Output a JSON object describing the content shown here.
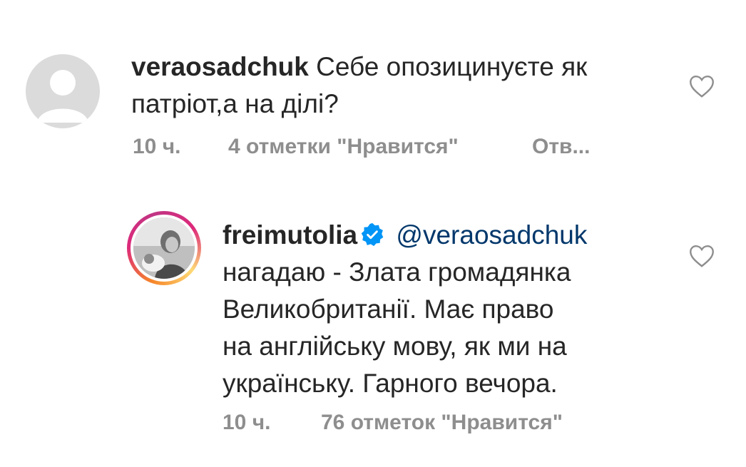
{
  "comments": [
    {
      "username": "veraosadchuk",
      "text_line1": " Себе опозицинуєте як",
      "text_line2": "патріот,а на ділі?",
      "time": "10 ч.",
      "likes": "4 отметки \"Нравится\"",
      "reply": "Отв..."
    },
    {
      "username": "freimutolia",
      "verified": true,
      "mention": "@veraosadchuk",
      "text_lines": [
        "нагадаю - Злата громадянка",
        "Великобританії. Має право",
        "на англійську мову, як ми на",
        "українську. Гарного вечора."
      ],
      "time": "10 ч.",
      "likes": "76 отметок \"Нравится\""
    }
  ],
  "colors": {
    "text": "#262626",
    "meta": "#8e8e8e",
    "mention": "#00376b",
    "verified": "#0095f6"
  },
  "icons": {
    "like": "heart-outline-icon",
    "verified": "verified-badge-icon"
  }
}
